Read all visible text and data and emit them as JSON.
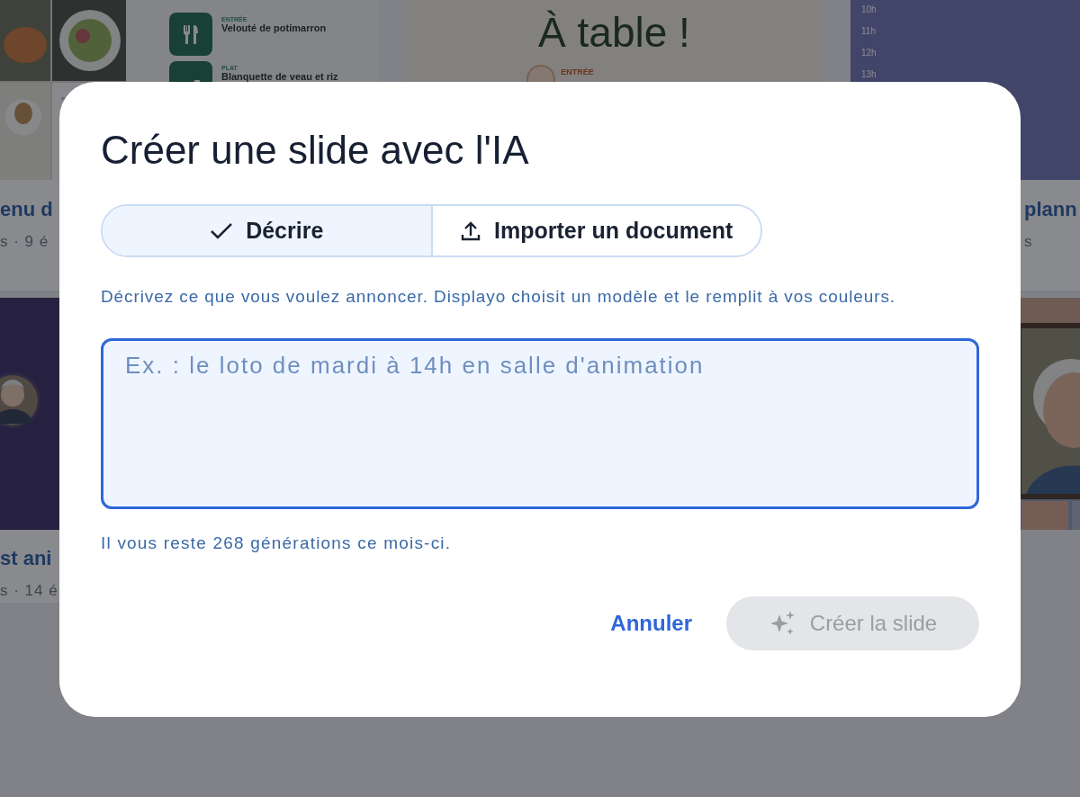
{
  "background": {
    "menu_card": {
      "title": "enu d",
      "meta": "s · 9 é",
      "courses": [
        {
          "label": "ENTRÉE",
          "name": "Velouté de potimarron"
        },
        {
          "label": "PLAT",
          "name": "Blanquette de veau et riz"
        }
      ]
    },
    "slide_card": {
      "heading": "À table !",
      "course_label": "ENTRÉE"
    },
    "schedule_card": {
      "title": "plann",
      "meta": "s",
      "hours": [
        "10h",
        "11h",
        "12h",
        "13h"
      ]
    },
    "portrait_card": {
      "title": "st ani",
      "meta": "s · 14 é"
    }
  },
  "dialog": {
    "title": "Créer une slide avec l'IA",
    "tabs": [
      {
        "label": "Décrire",
        "selected": true
      },
      {
        "label": "Importer un document",
        "selected": false
      }
    ],
    "hint": "Décrivez ce que vous voulez annoncer. Displayo choisit un modèle et le remplit à vos couleurs.",
    "prompt": {
      "placeholder": "Ex. : le loto de mardi à 14h en salle d'animation"
    },
    "quota": "Il vous reste 268 générations ce mois-ci.",
    "buttons": [
      {
        "kind": "text",
        "label": "Annuler",
        "disabled": false
      },
      {
        "kind": "primary",
        "label": "Créer la slide",
        "disabled": true
      }
    ]
  }
}
